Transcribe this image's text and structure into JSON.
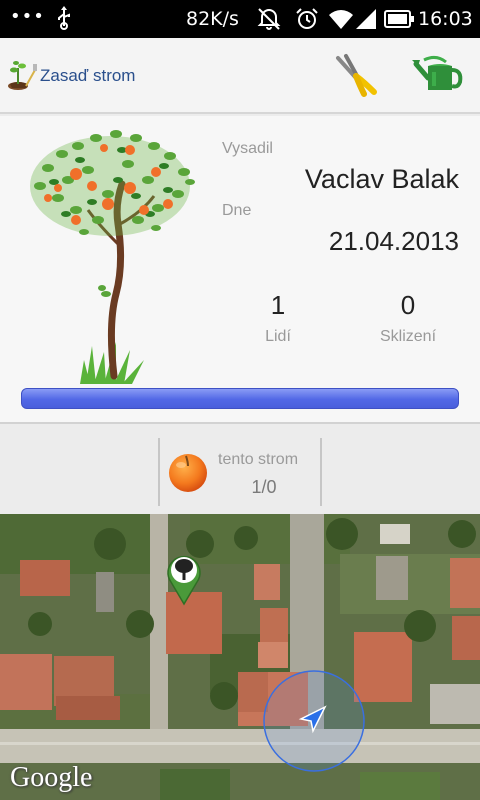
{
  "status_bar": {
    "network_speed": "82K/s",
    "time": "16:03",
    "icons": [
      "more-dots-icon",
      "usb-icon",
      "mute-icon",
      "alarm-icon",
      "wifi-icon",
      "signal-icon",
      "battery-icon"
    ]
  },
  "action_bar": {
    "title": "Zasaď strom",
    "actions": [
      "pruning-shears-icon",
      "watering-can-icon"
    ]
  },
  "tree_card": {
    "planted_by_label": "Vysadil",
    "planted_by_value": "Vaclav Balak",
    "date_label": "Dne",
    "date_value": "21.04.2013",
    "people_count": "1",
    "people_label": "Lidí",
    "harvests_count": "0",
    "harvests_label": "Sklizení",
    "progress": 1.0,
    "progress_color": "#5268e6"
  },
  "fruit_strip": {
    "caption": "tento strom",
    "count": "1/0",
    "fruit_icon": "peach-icon"
  },
  "map": {
    "attribution": "Google",
    "marker_icon": "tree-marker-icon",
    "location_icon": "my-location-arrow-icon"
  }
}
